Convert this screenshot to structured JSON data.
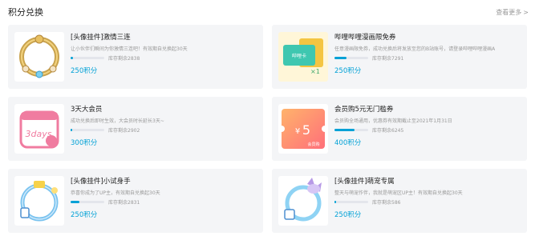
{
  "header": {
    "title": "积分兑换",
    "more": "查看更多"
  },
  "colors": {
    "accent": "#00a1d6",
    "bar_bg": "#e4e6eb"
  },
  "cards": [
    {
      "name": "[头像挂件]激情三连",
      "desc": "让小伙伴们瞬间为你激情三连吧！有效期自兑换起30天",
      "stock": "库存剩余2838",
      "price": "250积分",
      "progress": 0.06,
      "icon": "golden-frame-icon"
    },
    {
      "name": "哔哩哔哩漫画限免券",
      "desc": "任意漫画限免券，成功兑换后将发放至您的B站账号，请登录哔哩哔哩漫画APP领取使用",
      "stock": "库存剩余7291",
      "price": "250积分",
      "progress": 0.35,
      "icon": "comic-card-icon"
    },
    {
      "name": "3天大会员",
      "desc": "成功兑换后即时生效，大会员时长延长3天~",
      "stock": "库存剩余2902",
      "price": "300积分",
      "progress": 0.05,
      "icon": "3days-vip-icon"
    },
    {
      "name": "会员购5元无门槛券",
      "desc": "会员购全场通用，优惠券有效期截止至2021年1月31日",
      "stock": "库存剩余6245",
      "price": "400积分",
      "progress": 0.6,
      "icon": "coupon-icon"
    },
    {
      "name": "[头像挂件]小试身手",
      "desc": "恭喜你成为了UP主，有效期自兑换起30天",
      "stock": "库存剩余2831",
      "price": "250积分",
      "progress": 0.25,
      "icon": "blue-frame-icon"
    },
    {
      "name": "[头像挂件]萌宠专属",
      "desc": "整天与萌宠作伴，我就是萌宠区UP主！有效期自兑换起30天",
      "stock": "库存剩余586",
      "price": "250积分",
      "progress": 0.05,
      "icon": "cat-frame-icon"
    }
  ],
  "thumb_text": {
    "comic": "哔哩卡",
    "days": "3days",
    "coupon_value": "5",
    "coupon_label": "会员购"
  }
}
